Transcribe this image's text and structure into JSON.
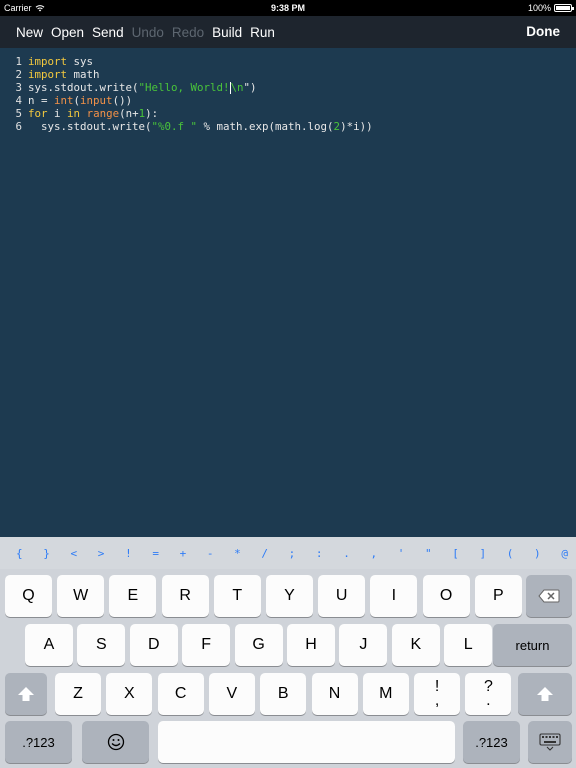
{
  "status": {
    "carrier": "Carrier",
    "time": "9:38 PM",
    "battery": "100%"
  },
  "toolbar": {
    "items": [
      {
        "label": "New",
        "enabled": true
      },
      {
        "label": "Open",
        "enabled": true
      },
      {
        "label": "Send",
        "enabled": true
      },
      {
        "label": "Undo",
        "enabled": false
      },
      {
        "label": "Redo",
        "enabled": false
      },
      {
        "label": "Build",
        "enabled": true
      },
      {
        "label": "Run",
        "enabled": true
      }
    ],
    "done": "Done"
  },
  "editor": {
    "lines": [
      {
        "n": "1",
        "tokens": [
          [
            "kw",
            "import"
          ],
          [
            "p",
            " sys"
          ]
        ]
      },
      {
        "n": "2",
        "tokens": [
          [
            "kw",
            "import"
          ],
          [
            "p",
            " math"
          ]
        ]
      },
      {
        "n": "3",
        "tokens": [
          [
            "p",
            "sys.stdout.write("
          ],
          [
            "str",
            "\"Hello, World!"
          ],
          [
            "caret",
            ""
          ],
          [
            "str",
            "\\n"
          ],
          [
            "p",
            "\")"
          ]
        ]
      },
      {
        "n": "4",
        "tokens": [
          [
            "p",
            "n = "
          ],
          [
            "fn",
            "int"
          ],
          [
            "p",
            "("
          ],
          [
            "fn",
            "input"
          ],
          [
            "p",
            "())"
          ]
        ]
      },
      {
        "n": "5",
        "tokens": [
          [
            "kw",
            "for"
          ],
          [
            "p",
            " i "
          ],
          [
            "kw",
            "in"
          ],
          [
            "p",
            " "
          ],
          [
            "fn",
            "range"
          ],
          [
            "p",
            "(n+"
          ],
          [
            "num",
            "1"
          ],
          [
            "p",
            "):"
          ]
        ]
      },
      {
        "n": "6",
        "tokens": [
          [
            "p",
            "  sys.stdout.write("
          ],
          [
            "str",
            "\"%0.f \""
          ],
          [
            "p",
            " % math.exp(math.log("
          ],
          [
            "num",
            "2"
          ],
          [
            "p",
            ")*i))"
          ]
        ]
      }
    ]
  },
  "symbols": [
    "{",
    "}",
    "<",
    ">",
    "!",
    "=",
    "+",
    "-",
    "*",
    "/",
    ";",
    ":",
    ".",
    ",",
    "'",
    "\"",
    "[",
    "]",
    "(",
    ")",
    "@"
  ],
  "keyboard": {
    "row1": [
      "Q",
      "W",
      "E",
      "R",
      "T",
      "Y",
      "U",
      "I",
      "O",
      "P"
    ],
    "row2": [
      "A",
      "S",
      "D",
      "F",
      "G",
      "H",
      "J",
      "K",
      "L"
    ],
    "row3": [
      "Z",
      "X",
      "C",
      "V",
      "B",
      "N",
      "M",
      "!\n,",
      "?\n."
    ],
    "return_label": "return",
    "numbers_label": ".?123",
    "icons": {
      "backspace": "backspace-icon",
      "shift": "shift-icon",
      "emoji": "emoji-icon",
      "dismiss": "keyboard-dismiss-icon",
      "wifi": "wifi-icon"
    }
  }
}
